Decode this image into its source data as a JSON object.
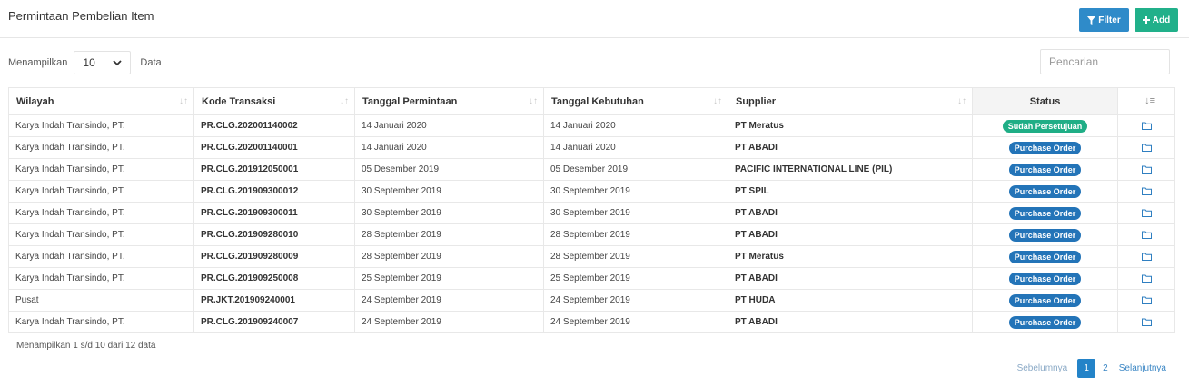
{
  "header": {
    "title": "Permintaan Pembelian Item",
    "filter_label": "Filter",
    "add_label": "Add"
  },
  "length": {
    "prefix": "Menampilkan",
    "value": "10",
    "suffix": "Data"
  },
  "search": {
    "placeholder": "Pencarian"
  },
  "table": {
    "columns": [
      "Wilayah",
      "Kode Transaksi",
      "Tanggal Permintaan",
      "Tanggal Kebutuhan",
      "Supplier",
      "Status"
    ],
    "rows": [
      {
        "wilayah": "Karya Indah Transindo, PT.",
        "kode": "PR.CLG.202001140002",
        "tgl_permintaan": "14 Januari 2020",
        "tgl_kebutuhan": "14 Januari 2020",
        "supplier": "PT Meratus",
        "status": "Sudah Persetujuan"
      },
      {
        "wilayah": "Karya Indah Transindo, PT.",
        "kode": "PR.CLG.202001140001",
        "tgl_permintaan": "14 Januari 2020",
        "tgl_kebutuhan": "14 Januari 2020",
        "supplier": "PT ABADI",
        "status": "Purchase Order"
      },
      {
        "wilayah": "Karya Indah Transindo, PT.",
        "kode": "PR.CLG.201912050001",
        "tgl_permintaan": "05 Desember 2019",
        "tgl_kebutuhan": "05 Desember 2019",
        "supplier": "PACIFIC INTERNATIONAL LINE (PIL)",
        "status": "Purchase Order"
      },
      {
        "wilayah": "Karya Indah Transindo, PT.",
        "kode": "PR.CLG.201909300012",
        "tgl_permintaan": "30 September 2019",
        "tgl_kebutuhan": "30 September 2019",
        "supplier": "PT SPIL",
        "status": "Purchase Order"
      },
      {
        "wilayah": "Karya Indah Transindo, PT.",
        "kode": "PR.CLG.201909300011",
        "tgl_permintaan": "30 September 2019",
        "tgl_kebutuhan": "30 September 2019",
        "supplier": "PT ABADI",
        "status": "Purchase Order"
      },
      {
        "wilayah": "Karya Indah Transindo, PT.",
        "kode": "PR.CLG.201909280010",
        "tgl_permintaan": "28 September 2019",
        "tgl_kebutuhan": "28 September 2019",
        "supplier": "PT ABADI",
        "status": "Purchase Order"
      },
      {
        "wilayah": "Karya Indah Transindo, PT.",
        "kode": "PR.CLG.201909280009",
        "tgl_permintaan": "28 September 2019",
        "tgl_kebutuhan": "28 September 2019",
        "supplier": "PT Meratus",
        "status": "Purchase Order"
      },
      {
        "wilayah": "Karya Indah Transindo, PT.",
        "kode": "PR.CLG.201909250008",
        "tgl_permintaan": "25 September 2019",
        "tgl_kebutuhan": "25 September 2019",
        "supplier": "PT ABADI",
        "status": "Purchase Order"
      },
      {
        "wilayah": "Pusat",
        "kode": "PR.JKT.201909240001",
        "tgl_permintaan": "24 September 2019",
        "tgl_kebutuhan": "24 September 2019",
        "supplier": "PT HUDA",
        "status": "Purchase Order"
      },
      {
        "wilayah": "Karya Indah Transindo, PT.",
        "kode": "PR.CLG.201909240007",
        "tgl_permintaan": "24 September 2019",
        "tgl_kebutuhan": "24 September 2019",
        "supplier": "PT ABADI",
        "status": "Purchase Order"
      }
    ]
  },
  "footer": {
    "info": "Menampilkan 1 s/d 10 dari 12 data",
    "prev": "Sebelumnya",
    "pages": [
      "1",
      "2"
    ],
    "next": "Selanjutnya"
  },
  "icons": {
    "filter": "filter-icon",
    "add": "plus-icon",
    "row_action": "folder-icon",
    "sort": "sort-icon",
    "dropdown": "chevron-down-icon"
  },
  "colors": {
    "filter_button": "#2f8bc9",
    "add_button": "#21b08a",
    "badge_purchase_order": "#2374b8",
    "badge_approved": "#1fae86",
    "active_page": "#2383c8"
  }
}
